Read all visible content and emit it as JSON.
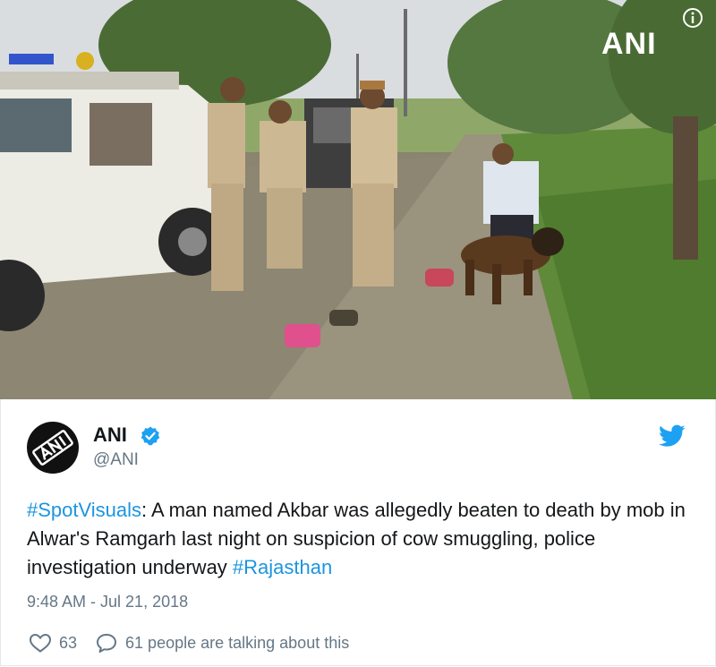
{
  "media": {
    "watermark": "ANI"
  },
  "tweet": {
    "display_name": "ANI",
    "handle": "@ANI",
    "text_hashtag_start": "#SpotVisuals",
    "text_body": ": A man named Akbar was allegedly beaten to death by mob in Alwar's Ramgarh last night on suspicion of cow smuggling, police investigation underway ",
    "text_hashtag_end": "#Rajasthan",
    "timestamp": "9:48 AM - Jul 21, 2018",
    "like_count": "63",
    "conversation_text": "61 people are talking about this"
  },
  "colors": {
    "link": "#1b95e0",
    "secondary_text": "#657786",
    "verified": "#1da1f2",
    "twitter_bird": "#1da1f2"
  },
  "icons": [
    "info-icon",
    "verified-badge-icon",
    "twitter-bird-icon",
    "heart-icon",
    "reply-bubble-icon"
  ]
}
